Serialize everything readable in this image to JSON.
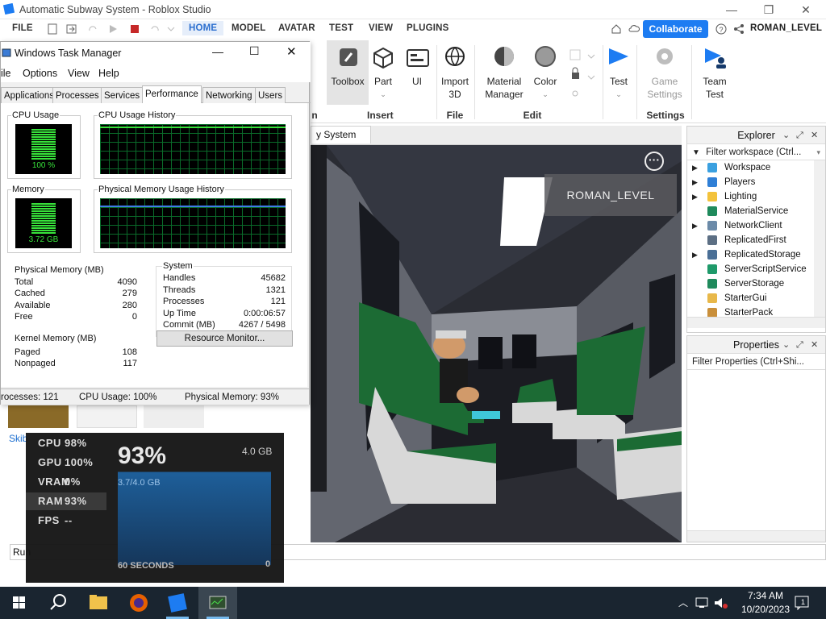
{
  "window": {
    "title": "Automatic Subway System - Roblox Studio",
    "min": "—",
    "max": "❐",
    "close": "✕"
  },
  "menubar": {
    "file": "FILE",
    "tabs": [
      "HOME",
      "MODEL",
      "AVATAR",
      "TEST",
      "VIEW",
      "PLUGINS"
    ],
    "active_tab": "HOME",
    "collaborate": "Collaborate",
    "username": "ROMAN_LEVEL"
  },
  "ribbon": {
    "toolbox": "Toolbox",
    "part": "Part",
    "ui": "UI",
    "import3d_1": "Import",
    "import3d_2": "3D",
    "material_1": "Material",
    "material_2": "Manager",
    "color": "Color",
    "test": "Test",
    "game_settings_1": "Game",
    "game_settings_2": "Settings",
    "team_test_1": "Team",
    "team_test_2": "Test",
    "groups": {
      "insert": "Insert",
      "file": "File",
      "edit": "Edit",
      "settings": "Settings",
      "partial": "n"
    }
  },
  "doc_tab": {
    "label": "y System",
    "close": "✕"
  },
  "viewport": {
    "user_badge": "ROMAN_LEVEL",
    "menu": "···"
  },
  "explorer": {
    "title": "Explorer",
    "filter": "Filter workspace (Ctrl...",
    "items": [
      {
        "label": "Workspace",
        "expand": true,
        "color": "#3aa0e0"
      },
      {
        "label": "Players",
        "expand": true,
        "color": "#2f7fd6"
      },
      {
        "label": "Lighting",
        "expand": true,
        "color": "#f3c23b"
      },
      {
        "label": "MaterialService",
        "expand": false,
        "color": "#1f8a5c"
      },
      {
        "label": "NetworkClient",
        "expand": true,
        "color": "#6b8aa8"
      },
      {
        "label": "ReplicatedFirst",
        "expand": false,
        "color": "#5c6f84"
      },
      {
        "label": "ReplicatedStorage",
        "expand": true,
        "color": "#4a6f96"
      },
      {
        "label": "ServerScriptService",
        "expand": false,
        "color": "#1f9a6a"
      },
      {
        "label": "ServerStorage",
        "expand": false,
        "color": "#1f8a5c"
      },
      {
        "label": "StarterGui",
        "expand": false,
        "color": "#e8b84a"
      },
      {
        "label": "StarterPack",
        "expand": false,
        "color": "#c98f3a"
      }
    ]
  },
  "properties": {
    "title": "Properties",
    "filter": "Filter Properties (Ctrl+Shi..."
  },
  "taskmgr": {
    "title": "Windows Task Manager",
    "menu": [
      "ile",
      "Options",
      "View",
      "Help"
    ],
    "tabs": [
      "Applications",
      "Processes",
      "Services",
      "Performance",
      "Networking",
      "Users"
    ],
    "active_tab": "Performance",
    "cpu_usage_label": "CPU Usage",
    "cpu_usage_value": "100 %",
    "cpu_history_label": "CPU Usage History",
    "memory_label": "Memory",
    "memory_value": "3.72 GB",
    "mem_history_label": "Physical Memory Usage History",
    "physical_memory": {
      "title": "Physical Memory (MB)",
      "rows": [
        [
          "Total",
          "4090"
        ],
        [
          "Cached",
          "279"
        ],
        [
          "Available",
          "280"
        ],
        [
          "Free",
          "0"
        ]
      ]
    },
    "system": {
      "title": "System",
      "rows": [
        [
          "Handles",
          "45682"
        ],
        [
          "Threads",
          "1321"
        ],
        [
          "Processes",
          "121"
        ],
        [
          "Up Time",
          "0:00:06:57"
        ],
        [
          "Commit (MB)",
          "4267 / 5498"
        ]
      ]
    },
    "kernel_memory": {
      "title": "Kernel Memory (MB)",
      "rows": [
        [
          "Paged",
          "108"
        ],
        [
          "Nonpaged",
          "117"
        ]
      ]
    },
    "resource_monitor": "Resource Monitor...",
    "status": {
      "processes": "rocesses: 121",
      "cpu": "CPU Usage: 100%",
      "mem": "Physical Memory: 93%"
    }
  },
  "overlay": {
    "rows": [
      [
        "CPU",
        "98%"
      ],
      [
        "GPU",
        "100%"
      ],
      [
        "VRAM",
        "0%"
      ],
      [
        "RAM",
        "93%"
      ],
      [
        "FPS",
        "--"
      ]
    ],
    "big": "93%",
    "max": "4.0 GB",
    "used": "3.7/4.0 GB",
    "span": "60 SECONDS",
    "zero": "0",
    "ram_fraction": 0.93
  },
  "behind": {
    "skib": "Skib",
    "run": "Run"
  },
  "taskbar": {
    "time": "7:34 AM",
    "date": "10/20/2023",
    "notif_count": "1"
  }
}
